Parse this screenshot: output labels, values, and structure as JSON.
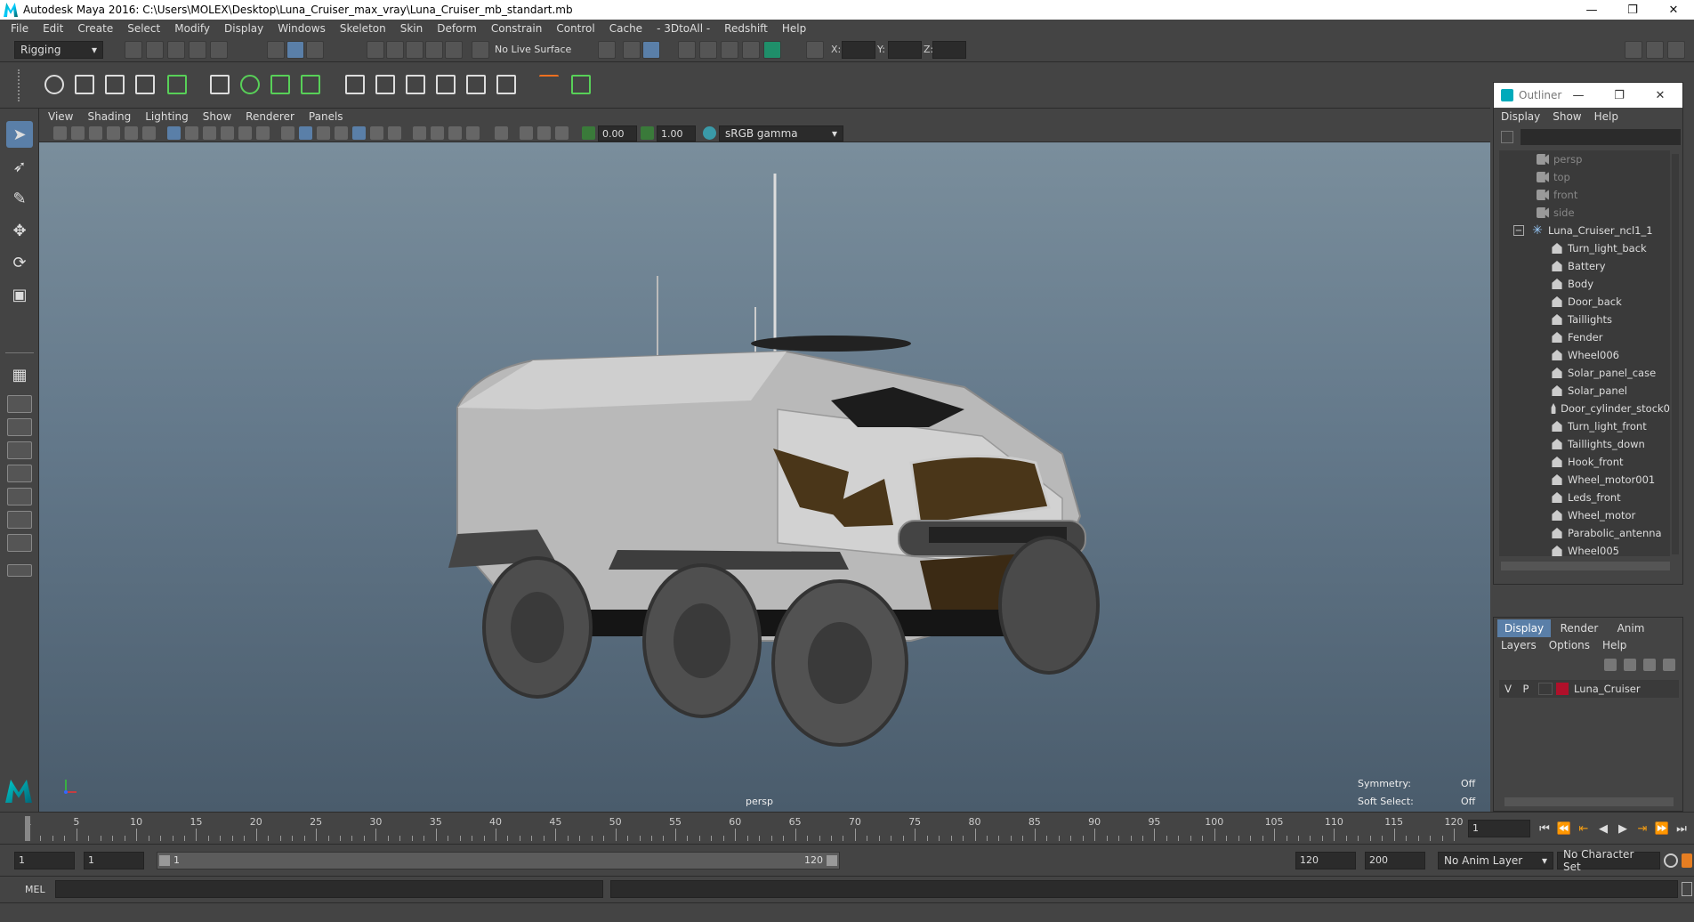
{
  "window": {
    "title": "Autodesk Maya 2016: C:\\Users\\MOLEX\\Desktop\\Luna_Cruiser_max_vray\\Luna_Cruiser_mb_standart.mb",
    "minimize": "—",
    "maximize": "❐",
    "close": "✕"
  },
  "menus": [
    "File",
    "Edit",
    "Create",
    "Select",
    "Modify",
    "Display",
    "Windows",
    "Skeleton",
    "Skin",
    "Deform",
    "Constrain",
    "Control",
    "Cache",
    "- 3DtoAll -",
    "Redshift",
    "Help"
  ],
  "status_line": {
    "menu_set": "Rigging",
    "live_surface": "No Live Surface",
    "x_label": "X:",
    "y_label": "Y:",
    "z_label": "Z:"
  },
  "panel_menu": [
    "View",
    "Shading",
    "Lighting",
    "Show",
    "Renderer",
    "Panels"
  ],
  "panel_toolbar": {
    "exposure": "0.00",
    "gamma": "1.00",
    "color_space": "sRGB gamma"
  },
  "viewport": {
    "camera": "persp",
    "symmetry_label": "Symmetry:",
    "symmetry_value": "Off",
    "soft_select_label": "Soft Select:",
    "soft_select_value": "Off"
  },
  "outliner": {
    "title": "Outliner",
    "menu": [
      "Display",
      "Show",
      "Help"
    ],
    "cameras": [
      "persp",
      "top",
      "front",
      "side"
    ],
    "group": "Luna_Cruiser_ncl1_1",
    "items": [
      "Turn_light_back",
      "Battery",
      "Body",
      "Door_back",
      "Taillights",
      "Fender",
      "Wheel006",
      "Solar_panel_case",
      "Solar_panel",
      "Door_cylinder_stock0",
      "Turn_light_front",
      "Taillights_down",
      "Hook_front",
      "Wheel_motor001",
      "Leds_front",
      "Wheel_motor",
      "Parabolic_antenna",
      "Wheel005"
    ]
  },
  "layers": {
    "tabs": [
      "Display",
      "Render",
      "Anim"
    ],
    "menu": [
      "Layers",
      "Options",
      "Help"
    ],
    "row": {
      "v": "V",
      "p": "P",
      "name": "Luna_Cruiser",
      "color": "#b0102a"
    }
  },
  "time_slider": {
    "tick_labels": [
      "1",
      "5",
      "10",
      "15",
      "20",
      "25",
      "30",
      "35",
      "40",
      "45",
      "50",
      "55",
      "60",
      "65",
      "70",
      "75",
      "80",
      "85",
      "90",
      "95",
      "100",
      "105",
      "110",
      "115",
      "120"
    ],
    "current_frame": "1"
  },
  "range_slider": {
    "start": "1",
    "playback_start": "1",
    "range_start_label": "1",
    "range_end_label": "120",
    "playback_end": "120",
    "end": "200",
    "anim_layer": "No Anim Layer",
    "character_set": "No Character Set"
  },
  "command_line": {
    "label": "MEL"
  },
  "colors": {
    "accent": "#5a7fa8",
    "layer": "#b0102a"
  }
}
